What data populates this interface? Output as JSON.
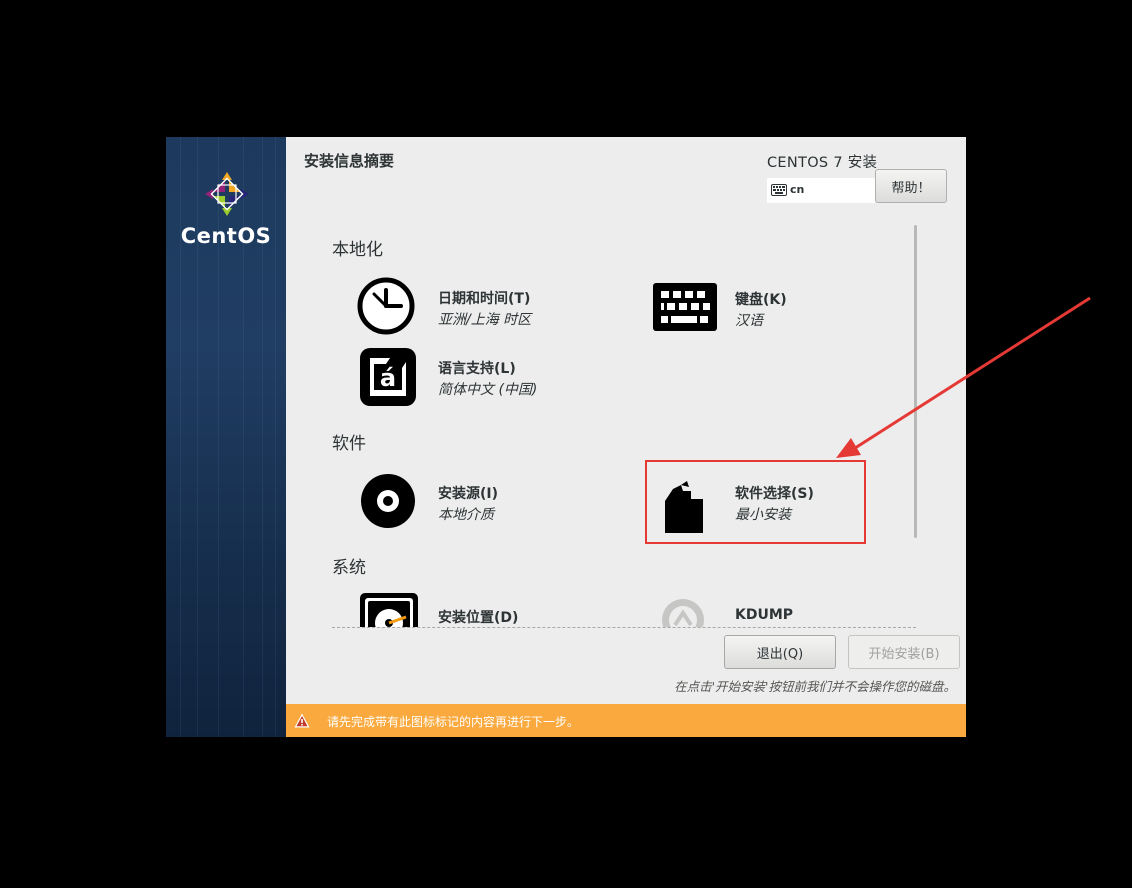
{
  "sidebar": {
    "brand": "CentOS"
  },
  "header": {
    "page_title": "安装信息摘要",
    "product_title": "CENTOS 7 安装",
    "keyboard_layout": "cn",
    "help_label": "帮助！"
  },
  "sections": {
    "localization": {
      "title": "本地化",
      "datetime": {
        "title": "日期和时间(T)",
        "status": "亚洲/上海 时区",
        "icon": "clock-icon"
      },
      "keyboard": {
        "title": "键盘(K)",
        "status": "汉语",
        "icon": "keyboard-icon"
      },
      "language": {
        "title": "语言支持(L)",
        "status": "简体中文 (中国)",
        "icon": "language-icon"
      }
    },
    "software": {
      "title": "软件",
      "source": {
        "title": "安装源(I)",
        "status": "本地介质",
        "icon": "disc-icon"
      },
      "selection": {
        "title": "软件选择(S)",
        "status": "最小安装",
        "icon": "package-icon"
      }
    },
    "system": {
      "title": "系统",
      "destination": {
        "title": "安装位置(D)",
        "icon": "harddisk-icon"
      },
      "kdump": {
        "title": "KDUMP",
        "icon": "kdump-icon"
      }
    }
  },
  "footer": {
    "quit_label": "退出(Q)",
    "begin_label": "开始安装(B)",
    "note": "在点击'开始安装'按钮前我们并不会操作您的磁盘。"
  },
  "warning": {
    "text": "请先完成带有此图标标记的内容再进行下一步。",
    "icon": "warning-icon"
  },
  "annotation": {
    "color": "#e53935"
  }
}
